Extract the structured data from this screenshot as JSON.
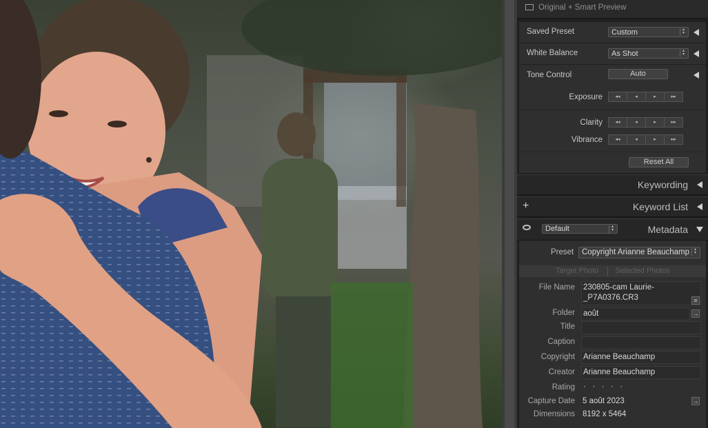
{
  "app": {
    "accent": "#cfcfcf",
    "panel_bg": "#2f2f2f"
  },
  "preview": {
    "icon": "preview-icon",
    "label": "Original + Smart Preview"
  },
  "quick_develop": {
    "saved_preset": {
      "label": "Saved Preset",
      "value": "Custom"
    },
    "white_balance": {
      "label": "White Balance",
      "value": "As Shot"
    },
    "tone_control": {
      "label": "Tone Control",
      "auto_label": "Auto"
    },
    "exposure": {
      "label": "Exposure"
    },
    "clarity": {
      "label": "Clarity"
    },
    "vibrance": {
      "label": "Vibrance"
    },
    "step_glyphs": [
      "◂◂",
      "◂",
      "▸",
      "▸▸"
    ],
    "reset_label": "Reset All"
  },
  "keywording": {
    "title": "Keywording"
  },
  "keyword_list": {
    "title": "Keyword List",
    "add_glyph": "+"
  },
  "metadata": {
    "title": "Metadata",
    "view_select": "Default",
    "preset_label": "Preset",
    "preset_value": "Copyright Arianne Beauchamp",
    "tabs": [
      "Target Photo",
      "Selected Photos"
    ],
    "fields": {
      "file_name": {
        "label": "File Name",
        "value_line1": "230805-cam Laurie-",
        "value_line2": "_P7A0376.CR3"
      },
      "folder": {
        "label": "Folder",
        "value": "août"
      },
      "title": {
        "label": "Title",
        "value": ""
      },
      "caption": {
        "label": "Caption",
        "value": ""
      },
      "copyright": {
        "label": "Copyright",
        "value": "Arianne Beauchamp"
      },
      "creator": {
        "label": "Creator",
        "value": "Arianne Beauchamp"
      },
      "rating": {
        "label": "Rating",
        "value": "· · · · ·"
      },
      "capture_date": {
        "label": "Capture Date",
        "value": "5 août 2023"
      },
      "dimensions": {
        "label": "Dimensions",
        "value": "8192 x 5464"
      }
    }
  }
}
